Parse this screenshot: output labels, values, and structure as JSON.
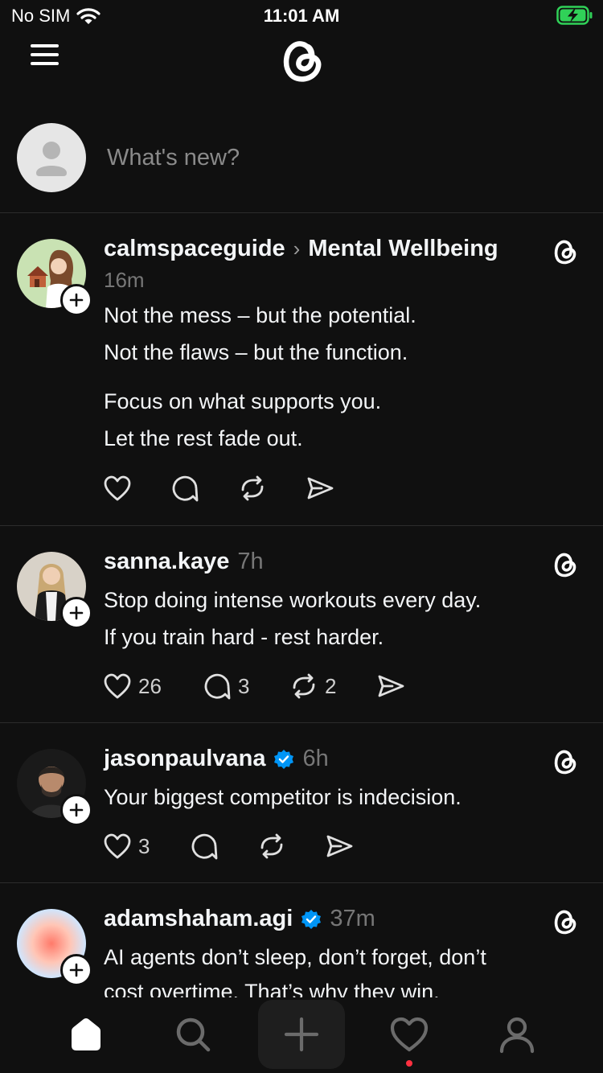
{
  "status_bar": {
    "carrier": "No SIM",
    "time": "11:01 AM"
  },
  "composer": {
    "placeholder": "What's new?"
  },
  "posts": [
    {
      "username": "calmspaceguide",
      "topic": "Mental Wellbeing",
      "time": "16m",
      "lines": [
        "Not the mess – but the potential.",
        "Not the flaws – but the function.",
        "Focus on what supports you.",
        "Let the rest fade out."
      ],
      "likes": "",
      "replies": "",
      "reposts": ""
    },
    {
      "username": "sanna.kaye",
      "time": "7h",
      "lines": [
        "Stop doing intense workouts every day.",
        "If you train hard - rest harder."
      ],
      "likes": "26",
      "replies": "3",
      "reposts": "2"
    },
    {
      "username": "jasonpaulvana",
      "verified": true,
      "time": "6h",
      "lines": [
        "Your biggest competitor is indecision."
      ],
      "likes": "3",
      "replies": "",
      "reposts": ""
    },
    {
      "username": "adamshaham.agi",
      "verified": true,
      "time": "37m",
      "lines": [
        "AI agents don’t sleep, don’t forget, don’t",
        "cost overtime. That’s why they win."
      ],
      "likes": "",
      "replies": "",
      "reposts": ""
    }
  ],
  "icons": {
    "status": [
      "wifi-icon",
      "battery-charging-icon"
    ],
    "header": [
      "hamburger-menu-icon",
      "threads-logo-icon"
    ],
    "actions": [
      "like-icon",
      "reply-icon",
      "repost-icon",
      "share-icon"
    ],
    "tabs": [
      "home-icon",
      "search-icon",
      "create-icon",
      "activity-icon",
      "profile-icon"
    ]
  },
  "colors": {
    "background": "#101010",
    "text": "#f3f5f7",
    "muted": "#777777",
    "verified": "#0095f6",
    "battery": "#30d158",
    "notification_dot": "#ff3040"
  }
}
